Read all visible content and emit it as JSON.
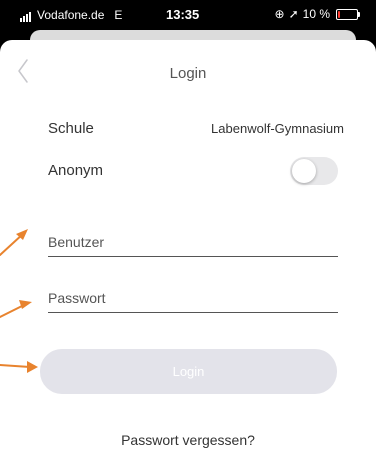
{
  "status_bar": {
    "carrier": "Vodafone.de",
    "network": "E",
    "time": "13:35",
    "battery_text": "10 %",
    "battery_level": 0.1,
    "battery_color": "#ff3b30"
  },
  "nav": {
    "back_icon": "chevron-left-icon",
    "title": "Login"
  },
  "form": {
    "school_label": "Schule",
    "school_value": "Labenwolf-Gymnasium",
    "anonym_label": "Anonym",
    "anonym_on": false,
    "username_placeholder": "Benutzer",
    "username_value": "",
    "password_placeholder": "Passwort",
    "password_value": "",
    "login_label": "Login",
    "forgot_label": "Passwort vergessen?"
  },
  "annotation": {
    "arrow_color": "#e8832e"
  }
}
